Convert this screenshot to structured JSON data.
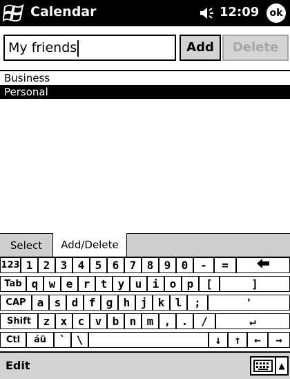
{
  "titlebar": {
    "app_title": "Calendar",
    "time": "12:09",
    "ok_label": "ok"
  },
  "category_input": {
    "value": "My friends",
    "add_label": "Add",
    "delete_label": "Delete"
  },
  "categories": [
    {
      "label": "Business",
      "selected": false
    },
    {
      "label": "Personal",
      "selected": true
    }
  ],
  "tabs": [
    {
      "label": "Select",
      "active": false
    },
    {
      "label": "Add/Delete",
      "active": true
    }
  ],
  "keyboard": {
    "rows": [
      [
        "123",
        "1",
        "2",
        "3",
        "4",
        "5",
        "6",
        "7",
        "8",
        "9",
        "0",
        "-",
        "=",
        "🡄"
      ],
      [
        "Tab",
        "q",
        "w",
        "e",
        "r",
        "t",
        "y",
        "u",
        "i",
        "o",
        "p",
        "[",
        "]"
      ],
      [
        "CAP",
        "a",
        "s",
        "d",
        "f",
        "g",
        "h",
        "j",
        "k",
        "l",
        ";",
        "'"
      ],
      [
        "Shift",
        "z",
        "x",
        "c",
        "v",
        "b",
        "n",
        "m",
        ",",
        ".",
        "/",
        "↵"
      ],
      [
        "Ctl",
        "áü",
        "`",
        "\\",
        "",
        "↓",
        "↑",
        "←",
        "→"
      ]
    ]
  },
  "menubar": {
    "edit_label": "Edit"
  },
  "icons": {
    "start": "windows-flag-icon",
    "volume": "speaker-icon",
    "input_panel": "keyboard-icon"
  }
}
